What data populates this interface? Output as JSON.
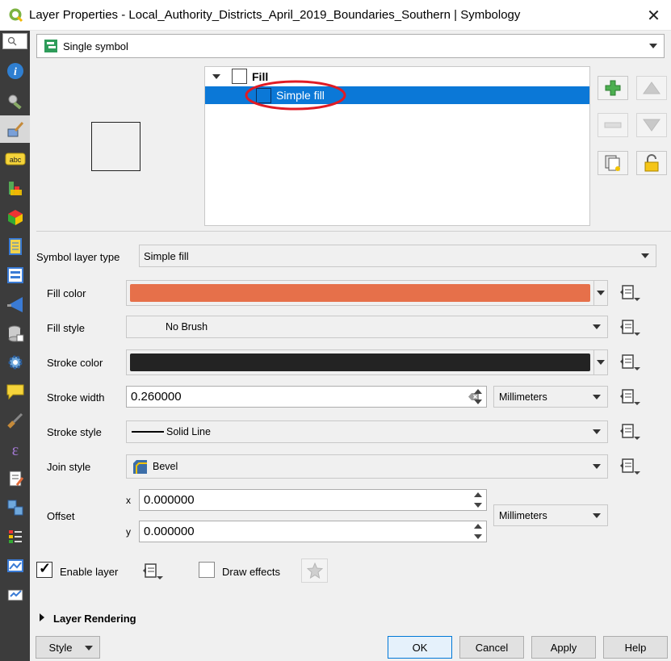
{
  "window": {
    "title": "Layer Properties - Local_Authority_Districts_April_2019_Boundaries_Southern | Symbology",
    "close": "✕"
  },
  "sidebar": {
    "search_icon": "magnifier-icon",
    "items": [
      {
        "icon": "information-icon"
      },
      {
        "icon": "source-settings-icon"
      },
      {
        "icon": "symbology-brush-icon",
        "active": true
      },
      {
        "icon": "labels-abc-icon",
        "text": "abc"
      },
      {
        "icon": "diagrams-icon"
      },
      {
        "icon": "3d-view-icon"
      },
      {
        "icon": "fields-icon"
      },
      {
        "icon": "attributes-form-icon"
      },
      {
        "icon": "joins-icon"
      },
      {
        "icon": "auxiliary-storage-icon"
      },
      {
        "icon": "actions-gear-icon"
      },
      {
        "icon": "display-tips-icon"
      },
      {
        "icon": "rendering-brush-icon"
      },
      {
        "icon": "variables-icon",
        "text": "ε"
      },
      {
        "icon": "metadata-icon"
      },
      {
        "icon": "dependencies-icon"
      },
      {
        "icon": "legend-icon"
      },
      {
        "icon": "qgis-server-icon"
      },
      {
        "icon": "digitizing-icon"
      }
    ]
  },
  "renderer": {
    "value": "Single symbol",
    "icon": "single-symbol-icon"
  },
  "tree": {
    "root_label": "Fill",
    "child_label": "Simple fill"
  },
  "side_buttons": {
    "add": "plus-icon",
    "up": "arrow-up-icon",
    "remove": "minus-icon",
    "down": "arrow-down-icon",
    "duplicate": "duplicate-icon",
    "lock": "lock-icon"
  },
  "symbol_layer_type": {
    "label": "Symbol layer type",
    "value": "Simple fill"
  },
  "fields": {
    "fill_color": {
      "label": "Fill color",
      "color": "#e6704a"
    },
    "fill_style": {
      "label": "Fill style",
      "value": "No Brush"
    },
    "stroke_color": {
      "label": "Stroke color",
      "color": "#232323"
    },
    "stroke_width": {
      "label": "Stroke width",
      "value": "0.260000",
      "unit": "Millimeters"
    },
    "stroke_style": {
      "label": "Stroke style",
      "value": "Solid Line"
    },
    "join_style": {
      "label": "Join style",
      "value": "Bevel"
    },
    "offset": {
      "label": "Offset",
      "x_label": "x",
      "x_value": "0.000000",
      "y_label": "y",
      "y_value": "0.000000",
      "unit": "Millimeters"
    }
  },
  "enable_layer": {
    "label": "Enable layer",
    "checked": true,
    "mark": "✓"
  },
  "draw_effects": {
    "label": "Draw effects",
    "checked": false
  },
  "layer_rendering": {
    "label": "Layer Rendering"
  },
  "buttons": {
    "style": "Style",
    "ok": "OK",
    "cancel": "Cancel",
    "apply": "Apply",
    "help": "Help"
  },
  "colors": {
    "selection": "#0b78d7",
    "highlight_ellipse": "#e01b24"
  }
}
